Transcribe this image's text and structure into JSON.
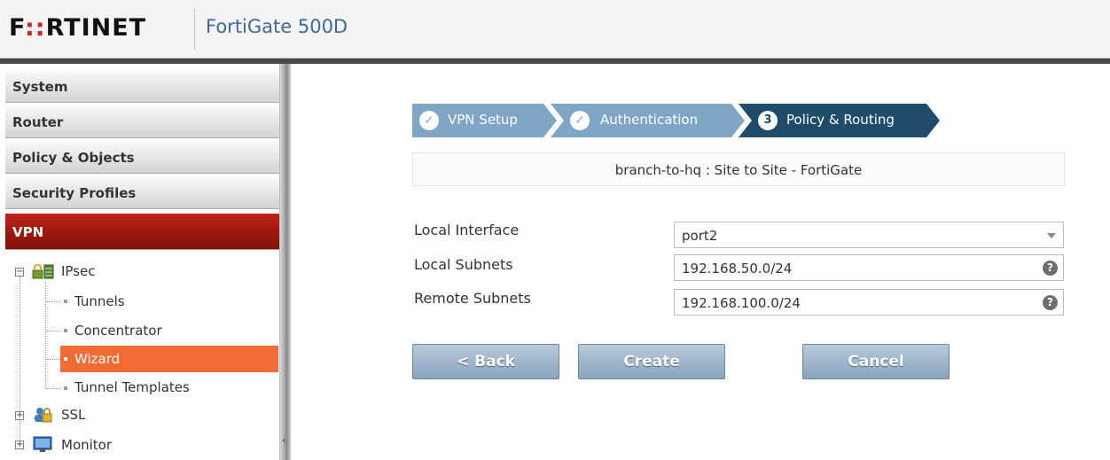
{
  "header": {
    "logo_part1": "F",
    "logo_part2": "RTINET",
    "logo_mid": "::",
    "device": "FortiGate 500D"
  },
  "sidebar": {
    "items": [
      {
        "label": "System"
      },
      {
        "label": "Router"
      },
      {
        "label": "Policy & Objects"
      },
      {
        "label": "Security Profiles"
      },
      {
        "label": "VPN"
      }
    ],
    "tree": {
      "ipsec": "IPsec",
      "tunnels": "Tunnels",
      "concentrator": "Concentrator",
      "wizard": "Wizard",
      "tunnel_templates": "Tunnel Templates",
      "ssl": "SSL",
      "monitor": "Monitor"
    }
  },
  "wizard": {
    "steps": [
      {
        "label": "VPN Setup",
        "state": "done"
      },
      {
        "label": "Authentication",
        "state": "done"
      },
      {
        "label": "Policy & Routing",
        "state": "current",
        "number": "3"
      }
    ],
    "name": "branch-to-hq : Site to Site - FortiGate"
  },
  "form": {
    "local_interface_label": "Local Interface",
    "local_interface_value": "port2",
    "local_subnets_label": "Local Subnets",
    "local_subnets_value": "192.168.50.0/24",
    "remote_subnets_label": "Remote Subnets",
    "remote_subnets_value": "192.168.100.0/24"
  },
  "buttons": {
    "back": "< Back",
    "create": "Create",
    "cancel": "Cancel"
  },
  "colors": {
    "active_menu": "#9e1a10",
    "selected_tree": "#f26a35",
    "wizard_done": "#7fa6c6",
    "wizard_current": "#1f4c6a",
    "button": "#9bb3cb"
  }
}
